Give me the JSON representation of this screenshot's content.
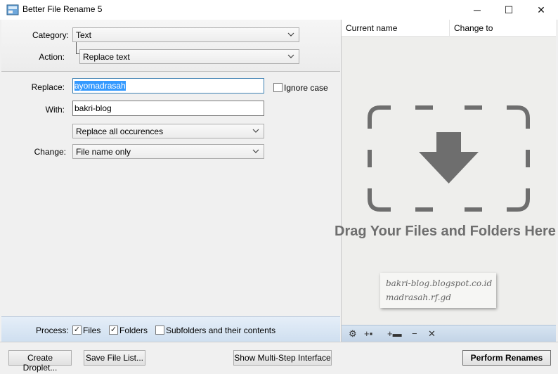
{
  "window": {
    "title": "Better File Rename 5",
    "minimize_glyph": "─",
    "maximize_glyph": "☐",
    "close_glyph": "✕"
  },
  "form": {
    "category_label": "Category:",
    "category_value": "Text",
    "action_label": "Action:",
    "action_value": "Replace text",
    "replace_label": "Replace:",
    "replace_value": "ayomadrasah",
    "ignore_case_label": "Ignore case",
    "ignore_case_checked": false,
    "with_label": "With:",
    "with_value": "bakri-blog",
    "occurrence_value": "Replace all occurences",
    "change_label": "Change:",
    "change_value": "File name only"
  },
  "process": {
    "label": "Process:",
    "files_label": "Files",
    "files_checked": true,
    "folders_label": "Folders",
    "folders_checked": true,
    "subfolders_label": "Subfolders and their contents",
    "subfolders_checked": false
  },
  "file_list": {
    "col_current": "Current name",
    "col_change": "Change to",
    "drop_hint": "Drag Your Files and Folders Here",
    "watermark_line1": "bakri-blog.blogspot.co.id",
    "watermark_line2": "madrasah.rf.gd"
  },
  "toolbar_icons": [
    "gear-icon",
    "add-file-icon",
    "add-folder-icon",
    "remove-icon",
    "clear-icon"
  ],
  "buttons": {
    "create_droplet": "Create Droplet...",
    "save_file_list": "Save File List...",
    "show_multistep": "Show Multi-Step Interface",
    "perform_renames": "Perform Renames"
  },
  "colors": {
    "selection": "#3399ff",
    "process_bar": "#d6e3f1",
    "drop_icon": "#6e6e6e"
  }
}
